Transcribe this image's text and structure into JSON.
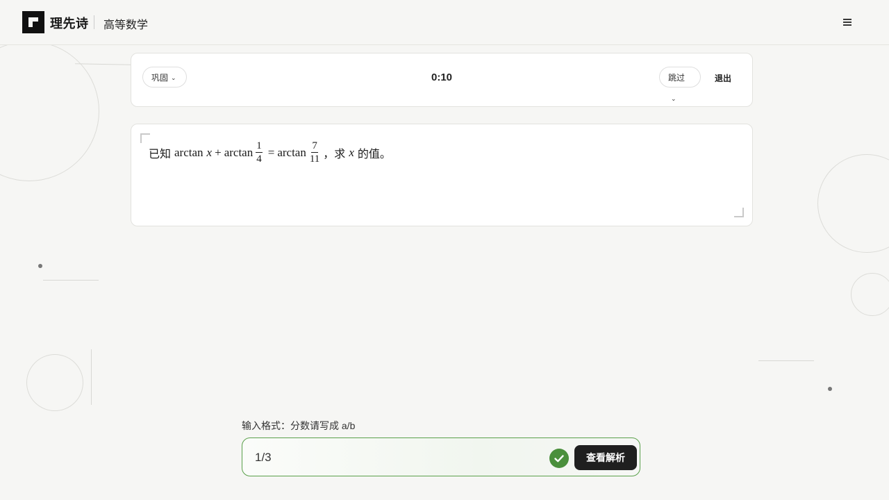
{
  "header": {
    "brand": "理先诗",
    "subject": "高等数学",
    "menu_icon": "hamburger-menu-icon"
  },
  "controls": {
    "mode_label": "巩固",
    "timer": "0:10",
    "skip_label": "跳过",
    "exit_label": "退出"
  },
  "question": {
    "prefix": "已知",
    "fn": "arctan",
    "var": "x",
    "plus": "+",
    "equals": "=",
    "frac1": {
      "num": "1",
      "den": "4"
    },
    "frac2": {
      "num": "7",
      "den": "11"
    },
    "mid": "，求",
    "suffix": "的值。"
  },
  "answer": {
    "format_hint": "输入格式：分数请写成 a/b",
    "value": "1/3",
    "status": "correct",
    "check_icon": "checkmark-circle-icon",
    "view_solution_label": "查看解析"
  },
  "colors": {
    "background": "#f6f6f4",
    "accent_green": "#4a8f3c",
    "dark_button": "#1f1f1f"
  }
}
